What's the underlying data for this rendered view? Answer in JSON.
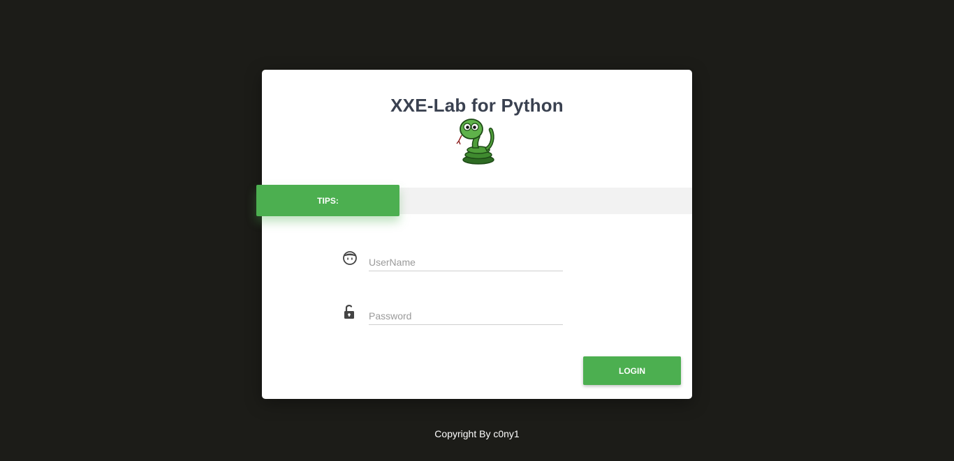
{
  "login_card": {
    "title": "XXE-Lab for Python",
    "logo_icon": "snake-icon",
    "tips_label": "TIPS:",
    "tips_text": "",
    "username": {
      "placeholder": "UserName",
      "value": "",
      "icon": "user-face-icon"
    },
    "password": {
      "placeholder": "Password",
      "value": "",
      "icon": "unlocked-padlock-icon"
    },
    "login_label": "LOGIN"
  },
  "footer": {
    "copyright": "Copyright By c0ny1"
  },
  "colors": {
    "background": "#1c1c18",
    "card": "#ffffff",
    "accent": "#4caf50",
    "title": "#3a4150",
    "tips_band": "#f2f2f2"
  }
}
